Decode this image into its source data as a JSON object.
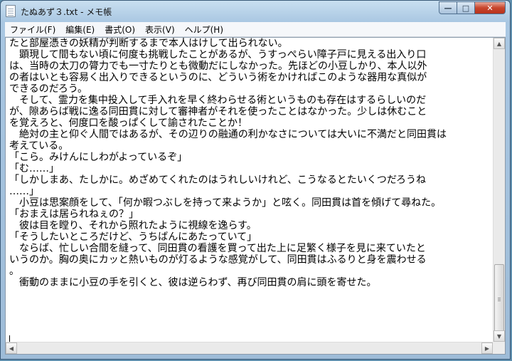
{
  "window": {
    "title": "たぬあず３.txt - メモ帳",
    "buttons": {
      "minimize": "—",
      "maximize": "□",
      "close": "✕"
    },
    "accent_colors": {
      "titlebar": "#a9c7e2",
      "close": "#c8452c"
    }
  },
  "menubar": {
    "items": [
      {
        "label": "ファイル(F)"
      },
      {
        "label": "編集(E)"
      },
      {
        "label": "書式(O)"
      },
      {
        "label": "表示(V)"
      },
      {
        "label": "ヘルプ(H)"
      }
    ]
  },
  "document": {
    "lines": [
      "たと部屋憑きの妖精が判断するまで本人はけして出られない。",
      "　顕現して間もない頃に何度も挑戦したことがあるが、うすっぺらい障子戸に見える出入り口",
      "は、当時の太刀の膂力でも一寸たりとも微動だにしなかった。先ほどの小豆しかり、本人以外",
      "の者はいとも容易く出入りできるというのに、どういう術をかければこのような器用な真似が",
      "できるのだろう。",
      "　そして、霊力を集中投入して手入れを早く終わらせる術というものも存在はするらしいのだ",
      "が、隙あらば戦に逸る同田貫に対して審神者がそれを使ったことはなかった。少しは休むこと",
      "を覚えろと、何度口を酸っぱくして諭されたことか！",
      "　絶対の主と仰ぐ人間ではあるが、その辺りの融通の利かなさについては大いに不満だと同田貫は",
      "考えている。",
      "「こら。みけんにしわがよっているぞ」",
      "「む……」",
      "「しかしまあ、たしかに。めざめてくれたのはうれしいけれど、こうなるとたいくつだろうね",
      "……」",
      "　小豆は思案顔をして、「何か暇つぶしを持って来ようか」と呟く。同田貫は首を傾げて尋ねた。",
      "「おまえは居られねぇの？」",
      "　彼は目を瞠り、それから照れたように視線を逸らす。",
      "「そうしたいところだけど、うちばんにあたっていて」",
      "　ならば、忙しい合間を縫って、同田貫の看護を買って出た上に足繁く様子を見に来ていたと",
      "いうのか。胸の奥にカッと熱いものが灯るような感覚がして、同田貫はふるりと身を震わせる",
      "。",
      "　衝動のままに小豆の手を引くと、彼は逆らわず、再び同田貫の肩に頭を寄せた。",
      "",
      "",
      ""
    ]
  },
  "scrollbars": {
    "up": "▲",
    "down": "▼",
    "left": "◀",
    "right": "▶",
    "vertical_position": 0.8
  }
}
